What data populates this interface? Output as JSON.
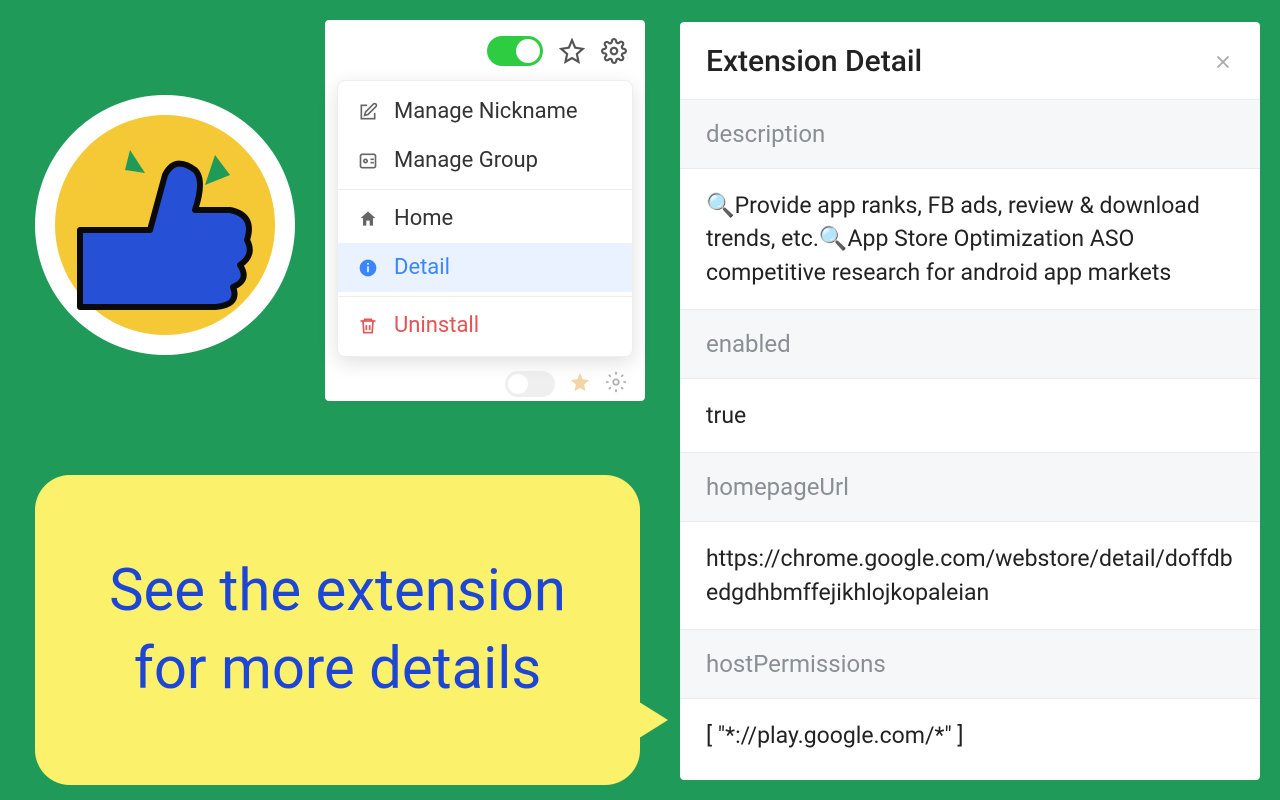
{
  "sticker": {
    "alt": "thumbs-up"
  },
  "speech": {
    "text": "See the extension for more details"
  },
  "menu": {
    "items": {
      "nickname": "Manage Nickname",
      "group": "Manage Group",
      "home": "Home",
      "detail": "Detail",
      "uninstall": "Uninstall"
    }
  },
  "detail": {
    "title": "Extension Detail",
    "fields": {
      "description": {
        "label": "description",
        "value": "🔍Provide app ranks, FB ads, review & download trends, etc.🔍App Store Optimization ASO competitive research for android app markets"
      },
      "enabled": {
        "label": "enabled",
        "value": "true"
      },
      "homepageUrl": {
        "label": "homepageUrl",
        "value": "https://chrome.google.com/webstore/detail/doffdbedgdhbmffejikhlojkopaleian"
      },
      "hostPermissions": {
        "label": "hostPermissions",
        "value": "[ \"*://play.google.com/*\" ]"
      }
    }
  }
}
